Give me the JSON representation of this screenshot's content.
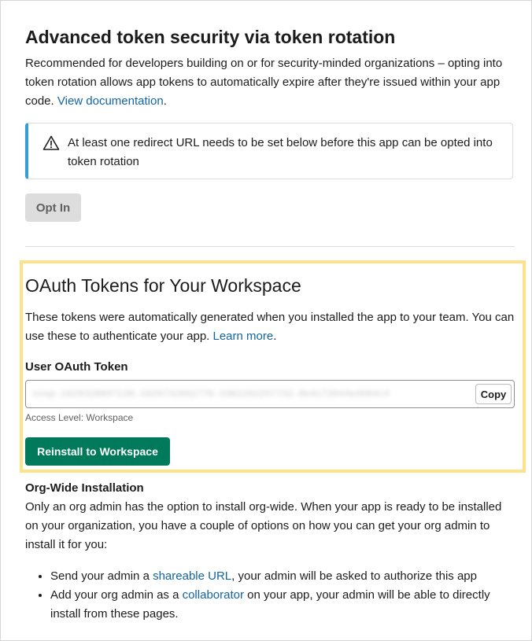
{
  "token_security": {
    "title": "Advanced token security via token rotation",
    "description": "Recommended for developers building on or for security-minded organizations – opting into token rotation allows app tokens to automatically expire after they're issued within your app code. ",
    "doc_link": "View documentation",
    "after_link": ".",
    "notice": {
      "icon": "warning-triangle-icon",
      "text": "At least one redirect URL needs to be set below before this app can be opted into token rotation",
      "accent_color": "#36a0d0"
    },
    "opt_in_label": "Opt In"
  },
  "oauth_tokens": {
    "title": "OAuth Tokens for Your Workspace",
    "description": "These tokens were automatically generated when you installed the app to your team. You can use these to authenticate your app. ",
    "learn_more_link": "Learn more",
    "after_link": ".",
    "user_token": {
      "label": "User OAuth Token",
      "value": "xoxp-1929328897128-1929732662776-3382292297732-8e4173944a4604c4",
      "copy_label": "Copy",
      "access_level": "Access Level: Workspace"
    },
    "reinstall_label": "Reinstall to Workspace",
    "highlight_color": "#fde28a",
    "button_color": "#007a5a"
  },
  "org_wide": {
    "title": "Org-Wide Installation",
    "description": "Only an org admin has the option to install org-wide. When your app is ready to be installed on your organization, you have a couple of options on how you can get your org admin to install it for you:",
    "bullets": [
      {
        "before": "Send your admin a ",
        "link": "shareable URL",
        "after": ", your admin will be asked to authorize this app"
      },
      {
        "before": "Add your org admin as a ",
        "link": "collaborator",
        "after": " on your app, your admin will be able to directly install from these pages."
      }
    ]
  },
  "link_color": "#1264a3"
}
